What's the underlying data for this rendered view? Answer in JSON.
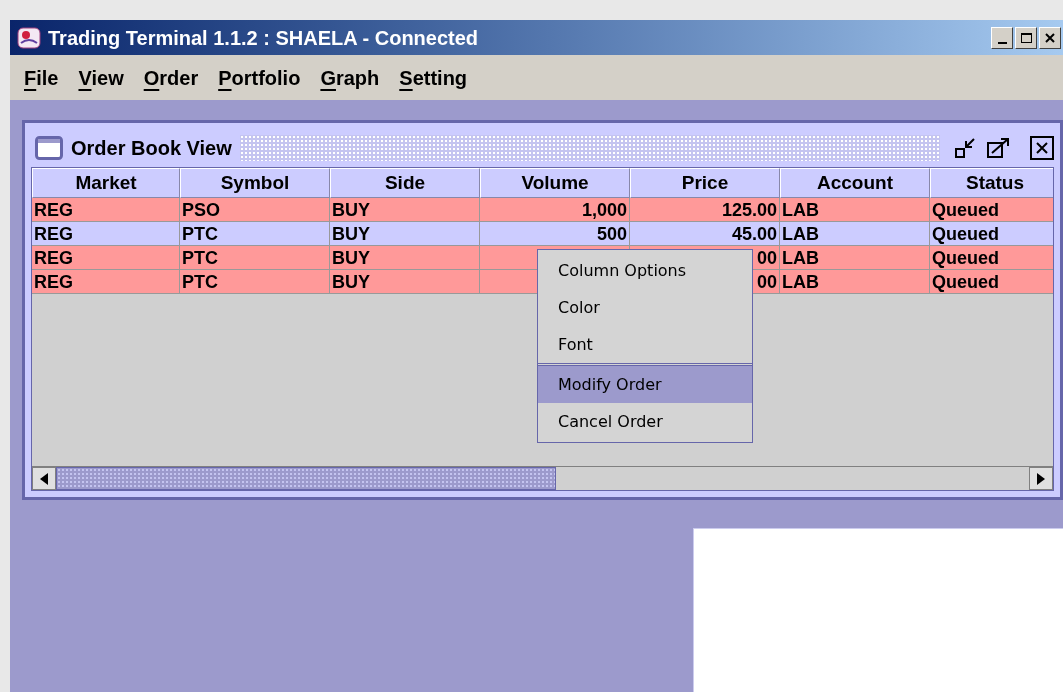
{
  "window": {
    "title": "Trading Terminal 1.1.2 : SHAELA - Connected"
  },
  "menu_bar": [
    "File",
    "View",
    "Order",
    "Portfolio",
    "Graph",
    "Setting"
  ],
  "internal_frame": {
    "title": "Order Book View",
    "columns": [
      {
        "label": "Market",
        "kind": "text"
      },
      {
        "label": "Symbol",
        "kind": "text"
      },
      {
        "label": "Side",
        "kind": "text"
      },
      {
        "label": "Volume",
        "kind": "number"
      },
      {
        "label": "Price",
        "kind": "number"
      },
      {
        "label": "Account",
        "kind": "text"
      },
      {
        "label": "Status",
        "kind": "text"
      }
    ],
    "rows": [
      {
        "color": "#ff9999",
        "cells": [
          "REG",
          "PSO",
          "BUY",
          "1,000",
          "125.00",
          "LAB",
          "Queued"
        ]
      },
      {
        "color": "#ccccff",
        "cells": [
          "REG",
          "PTC",
          "BUY",
          "500",
          "45.00",
          "LAB",
          "Queued"
        ]
      },
      {
        "color": "#ff9999",
        "cells": [
          "REG",
          "PTC",
          "BUY",
          null,
          "00",
          "LAB",
          "Queued"
        ]
      },
      {
        "color": "#ff9999",
        "cells": [
          "REG",
          "PTC",
          "BUY",
          null,
          "00",
          "LAB",
          "Queued"
        ]
      }
    ]
  },
  "context_menu": {
    "groups": [
      [
        {
          "label": "Column Options",
          "selected": false
        },
        {
          "label": "Color",
          "selected": false
        },
        {
          "label": "Font",
          "selected": false
        }
      ],
      [
        {
          "label": "Modify Order",
          "selected": true
        },
        {
          "label": "Cancel Order",
          "selected": false
        }
      ]
    ]
  }
}
